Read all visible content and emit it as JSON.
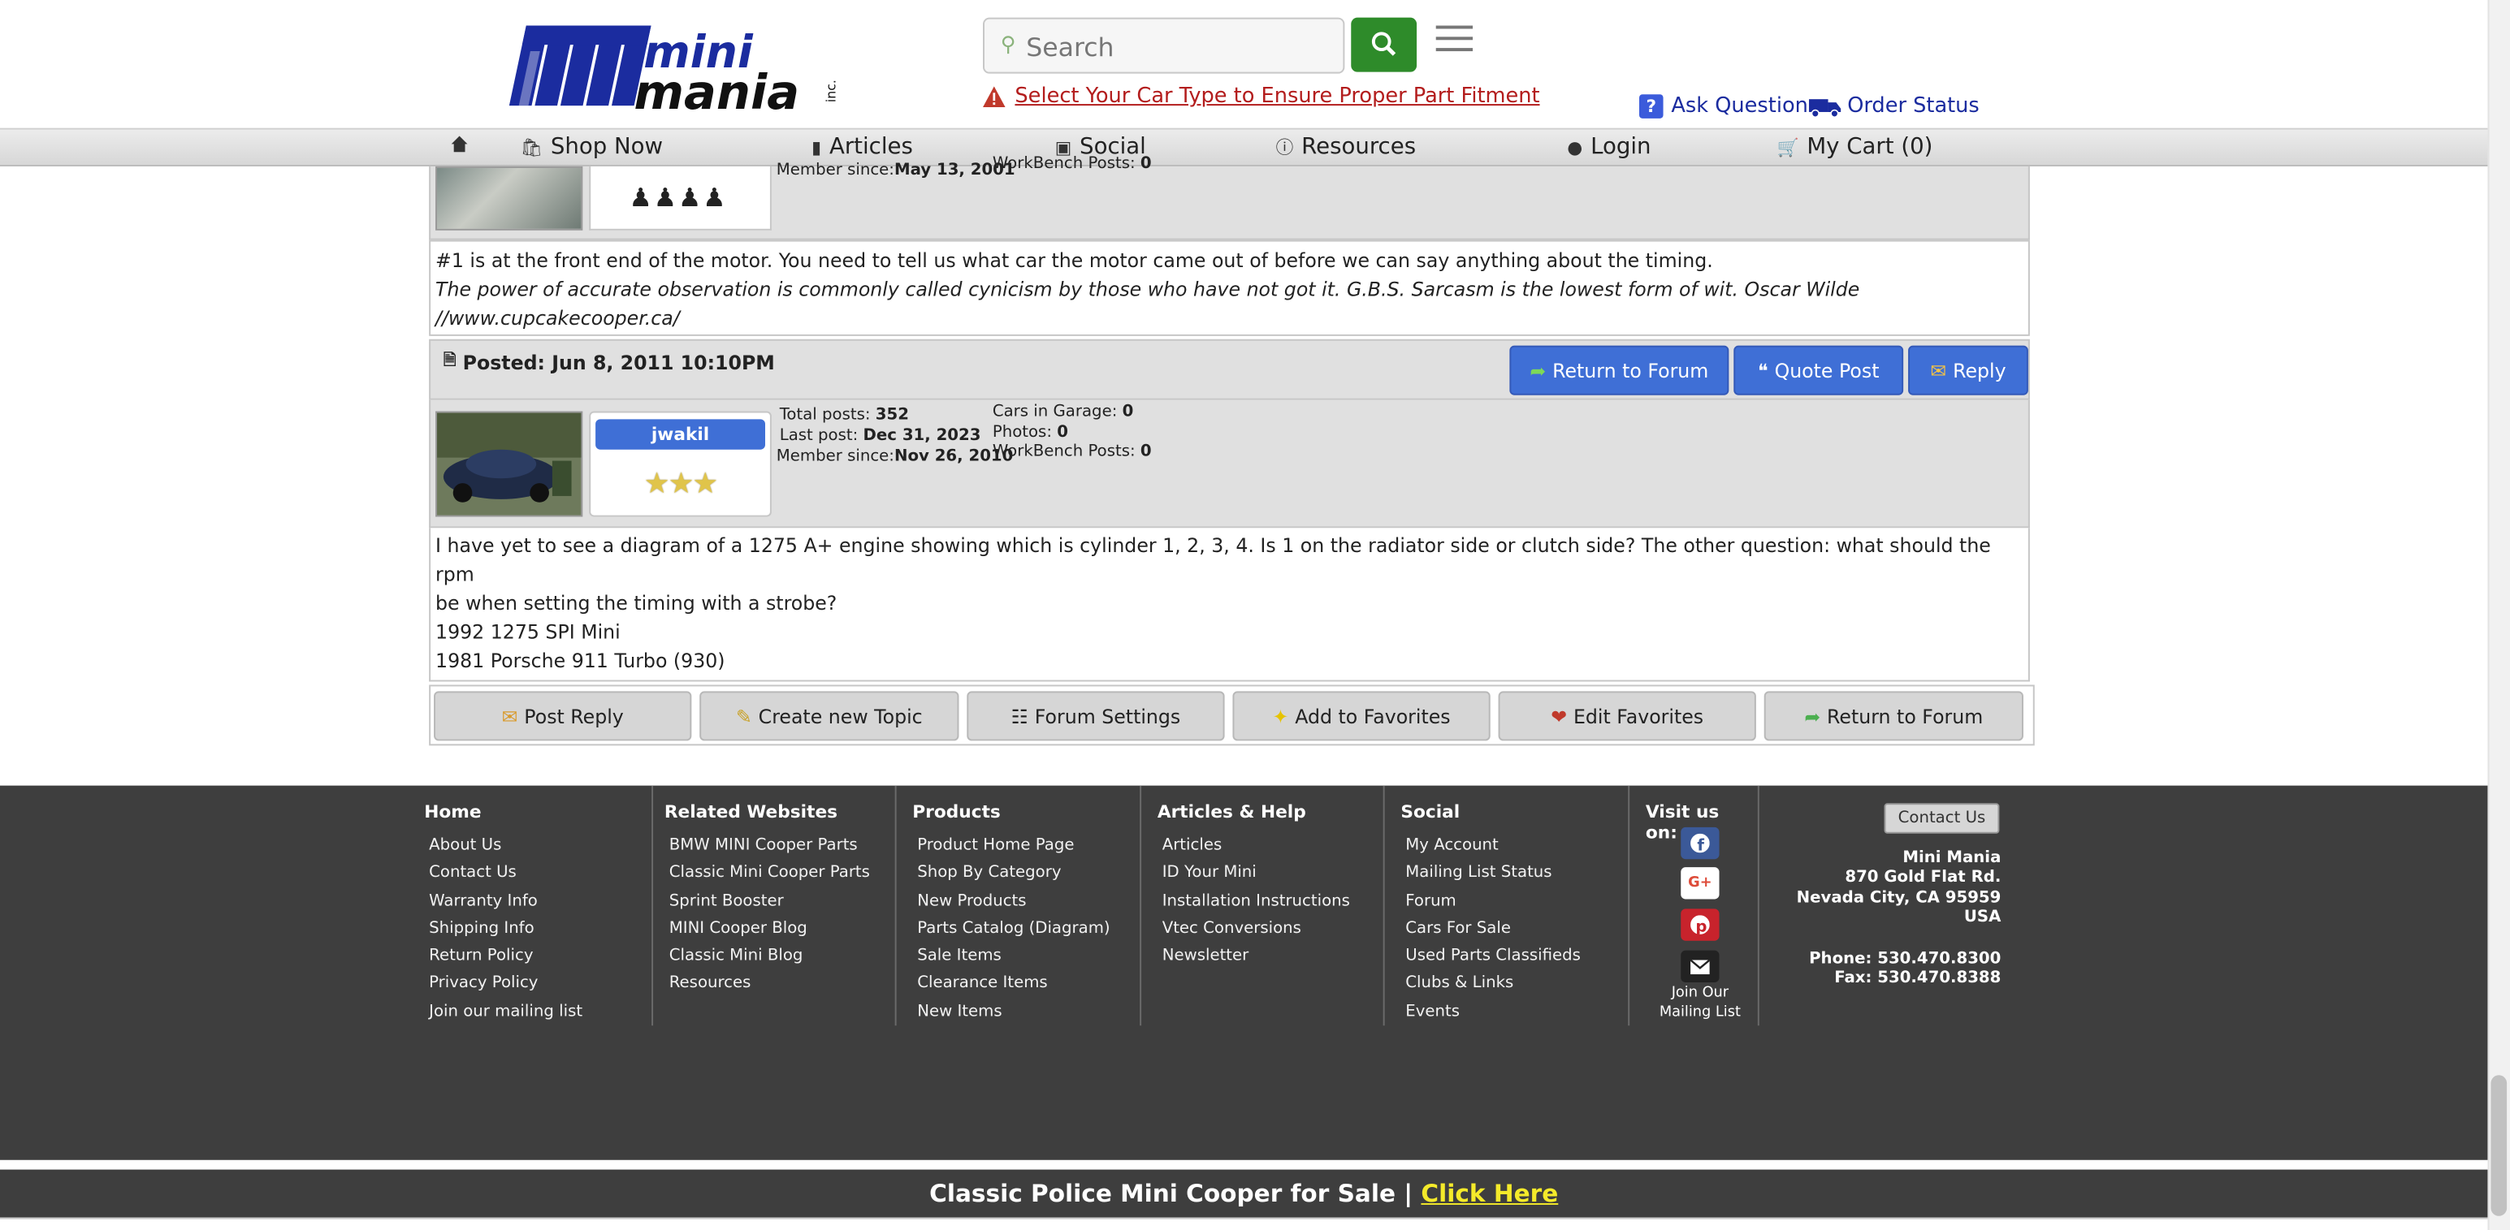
{
  "header": {
    "logo_alt": "Mini Mania Inc.",
    "search_placeholder": "Search",
    "fitment_link": "Select Your Car Type to Ensure Proper Part Fitment",
    "ask_question": "Ask Question",
    "order_status": "Order Status"
  },
  "nav": {
    "home_icon": "home-icon",
    "shop": "Shop Now",
    "articles": "Articles",
    "social": "Social",
    "resources": "Resources",
    "login": "Login",
    "cart": "My Cart (0)"
  },
  "prev_post": {
    "member_since_label": "Member since:",
    "member_since": "May 13, 2001",
    "workbench_label": "WorkBench Posts:",
    "workbench": "0",
    "body_line1": "#1 is at the front end of the motor. You need to tell us what car the motor came out of before we can say anything about the timing.",
    "signature": "The power of accurate observation is commonly called cynicism by those who have not got it. G.B.S. Sarcasm is the lowest form of wit. Oscar Wilde",
    "sig_url": "//www.cupcakecooper.ca/"
  },
  "post": {
    "posted": "Posted: Jun 8, 2011 10:10PM",
    "return_label": "Return to Forum",
    "quote_label": "Quote Post",
    "reply_label": "Reply",
    "username": "jwakil",
    "total_posts_label": "Total posts:",
    "total_posts": "352",
    "last_post_label": "Last post:",
    "last_post": "Dec 31, 2023",
    "member_since_label": "Member since:",
    "member_since": "Nov 26, 2010",
    "cars_label": "Cars in Garage:",
    "cars": "0",
    "photos_label": "Photos:",
    "photos": "0",
    "workbench_label": "WorkBench Posts:",
    "workbench": "0",
    "body_line1": "I have yet to see a diagram of a 1275 A+ engine showing which is cylinder 1, 2, 3, 4.  Is 1 on the radiator side or clutch side?  The other question: what should the rpm",
    "body_line2": "be when setting the timing with a strobe?",
    "sig1": "1992 1275 SPI Mini",
    "sig2": "1981 Porsche 911 Turbo (930)"
  },
  "actions": {
    "post_reply": "Post Reply",
    "new_topic": "Create new Topic",
    "settings": "Forum Settings",
    "add_fav": "Add to Favorites",
    "edit_fav": "Edit Favorites",
    "return": "Return to Forum"
  },
  "footer": {
    "home": {
      "title": "Home",
      "links": [
        "About Us",
        "Contact Us",
        "Warranty Info",
        "Shipping Info",
        "Return Policy",
        "Privacy Policy",
        "Join our mailing list"
      ]
    },
    "related": {
      "title": "Related Websites",
      "links": [
        "BMW MINI Cooper Parts",
        "Classic Mini Cooper Parts",
        "Sprint Booster",
        "MINI Cooper Blog",
        "Classic Mini Blog",
        "Resources"
      ]
    },
    "products": {
      "title": "Products",
      "links": [
        "Product Home Page",
        "Shop By Category",
        "New Products",
        "Parts Catalog (Diagram)",
        "Sale Items",
        "Clearance Items",
        "New Items"
      ]
    },
    "articles": {
      "title": "Articles & Help",
      "links": [
        "Articles",
        "ID Your Mini",
        "Installation Instructions",
        "Vtec Conversions",
        "Newsletter"
      ]
    },
    "social": {
      "title": "Social",
      "links": [
        "My Account",
        "Mailing List Status",
        "Forum",
        "Cars For Sale",
        "Used Parts Classifieds",
        "Clubs & Links",
        "Events"
      ]
    },
    "visit_title": "Visit us on:",
    "join_mailing": "Join Our Mailing List",
    "contact_btn": "Contact Us",
    "company": "Mini Mania",
    "street": "870 Gold Flat Rd.",
    "city": "Nevada City, CA 95959",
    "country": "USA",
    "phone": "Phone: 530.470.8300",
    "fax": "Fax: 530.470.8388"
  },
  "promo": {
    "text": "Classic Police Mini Cooper for Sale | ",
    "link": "Click Here"
  },
  "colors": {
    "brand_blue": "#1b2c9f",
    "search_green": "#2e8b2a",
    "button_blue": "#3f6fd6",
    "footer_bg": "#3e3e3e",
    "promo_link": "#f4ea2a"
  }
}
